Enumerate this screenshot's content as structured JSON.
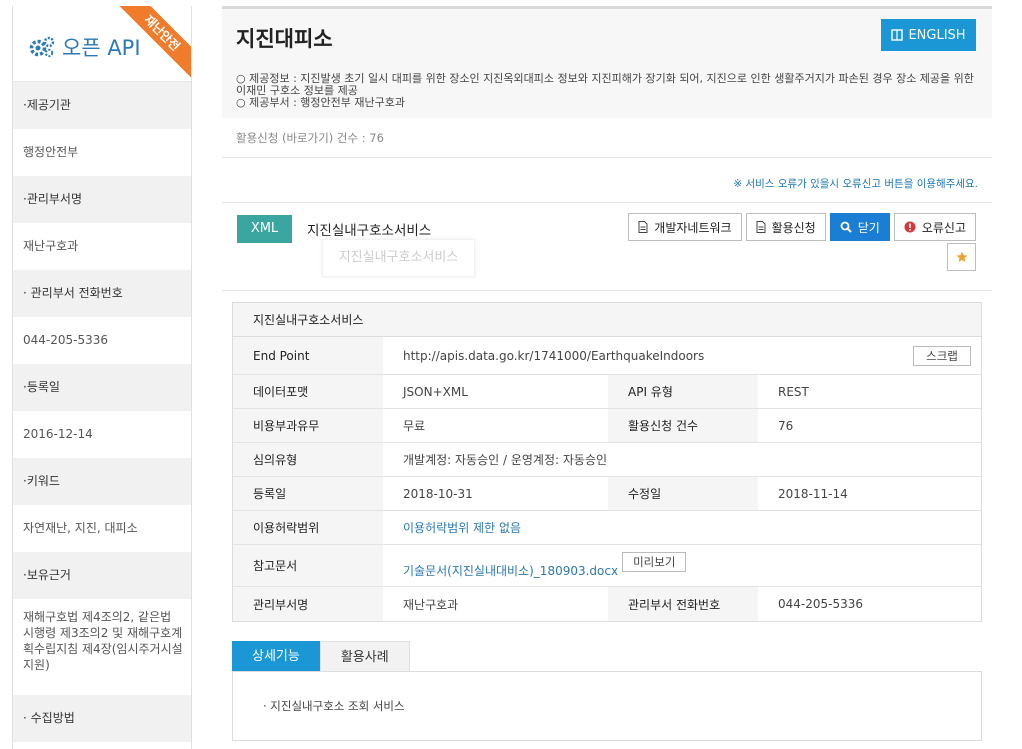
{
  "sidebar": {
    "title": "오픈 API",
    "ribbon": "재난안전",
    "items": [
      {
        "label": "·제공기관",
        "value": "행정안전부"
      },
      {
        "label": "·관리부서명",
        "value": "재난구호과"
      },
      {
        "label": "· 관리부서 전화번호",
        "value": "044-205-5336"
      },
      {
        "label": "·등록일",
        "value": "2016-12-14"
      },
      {
        "label": "·키워드",
        "value": "자연재난, 지진, 대피소"
      },
      {
        "label": "·보유근거",
        "value": "재해구호법 제4조의2, 같은법 시행령 제3조의2 및 재해구호계획수립지침 제4장(임시주거시설지원)"
      },
      {
        "label": "· 수집방법",
        "value": ""
      }
    ]
  },
  "header": {
    "title": "지진대피소",
    "english_label": "ENGLISH",
    "desc_line1": "○ 제공정보 : 지진발생 초기 일시 대피를 위한 장소인 지진옥외대피소 정보와 지진피해가 장기화 되어, 지진으로 인한 생활주거지가 파손된 경우 장소 제공을 위한 이재민 구호소 정보를 제공",
    "desc_line2": "○ 제공부서 : 행정안전부 재난구호과"
  },
  "usage_line": "활용신청 (바로가기) 건수 : 76",
  "notice": "※ 서비스 오류가 있을시 오류신고 버튼을 이용해주세요.",
  "service": {
    "badge": "XML",
    "name": "지진실내구호소서비스",
    "ghost_name": "지진실내구호소서비스",
    "buttons": {
      "dev_network": "개발자네트워크",
      "apply": "활용신청",
      "close": "닫기",
      "report": "오류신고"
    }
  },
  "detail": {
    "header": "지진실내구호소서비스",
    "endpoint_label": "End Point",
    "endpoint_value": "http://apis.data.go.kr/1741000/EarthquakeIndoors",
    "scrap_label": "스크랩",
    "format_label": "데이터포맷",
    "format_value": "JSON+XML",
    "api_type_label": "API 유형",
    "api_type_value": "REST",
    "fee_label": "비용부과유무",
    "fee_value": "무료",
    "apply_count_label": "활용신청 건수",
    "apply_count_value": "76",
    "review_label": "심의유형",
    "review_value": "개발계정: 자동승인 / 운영계정: 자동승인",
    "reg_date_label": "등록일",
    "reg_date_value": "2018-10-31",
    "mod_date_label": "수정일",
    "mod_date_value": "2018-11-14",
    "license_label": "이용허락범위",
    "license_value": "이용허락범위 제한 없음",
    "ref_label": "참고문서",
    "ref_value": "기술문서(지진실내대비소)_180903.docx",
    "preview_label": "미리보기",
    "dept_label": "관리부서명",
    "dept_value": "재난구호과",
    "phone_label": "관리부서 전화번호",
    "phone_value": "044-205-5336"
  },
  "tabs": {
    "detail_func": "상세기능",
    "use_cases": "활용사례",
    "panel_text": "· 지진실내구호소 조회 서비스"
  },
  "colors": {
    "primary_blue": "#1a97d4",
    "teal_badge": "#3ba6a0",
    "ribbon_orange": "#f07c2b",
    "report_red": "#d9383a"
  }
}
